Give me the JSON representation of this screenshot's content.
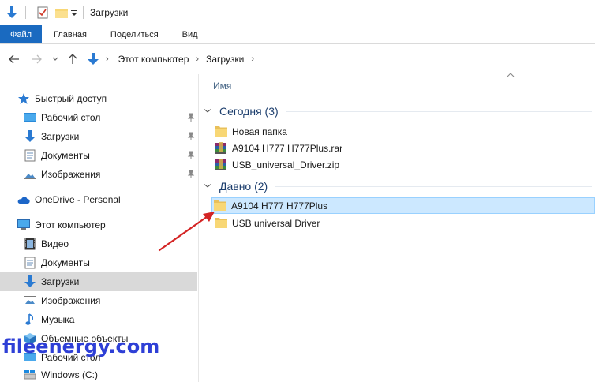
{
  "window": {
    "title": "Загрузки"
  },
  "ribbon": {
    "tabs": [
      "Файл",
      "Главная",
      "Поделиться",
      "Вид"
    ]
  },
  "address": {
    "crumbs": [
      "Этот компьютер",
      "Загрузки"
    ]
  },
  "sidebar": {
    "quick_access": "Быстрый доступ",
    "quick_items": [
      "Рабочий стол",
      "Загрузки",
      "Документы",
      "Изображения"
    ],
    "onedrive": "OneDrive - Personal",
    "this_pc": "Этот компьютер",
    "pc_items": [
      "Видео",
      "Документы",
      "Загрузки",
      "Изображения",
      "Музыка",
      "Объемные объекты",
      "Рабочий стол",
      "Windows (C:)"
    ]
  },
  "content": {
    "column_name": "Имя",
    "groups": [
      {
        "label": "Сегодня (3)",
        "items": [
          "Новая папка",
          "A9104 H777 H777Plus.rar",
          "USB_universal_Driver.zip"
        ]
      },
      {
        "label": "Давно (2)",
        "items": [
          "A9104 H777 H777Plus",
          "USB universal Driver"
        ]
      }
    ]
  },
  "watermark": "fileenergy.com",
  "colors": {
    "accent": "#1a6ac0",
    "selection": "#cce8ff",
    "sidebar_selected": "#d9d9d9",
    "arrow": "#d42424",
    "watermark": "#2e3fd6"
  }
}
